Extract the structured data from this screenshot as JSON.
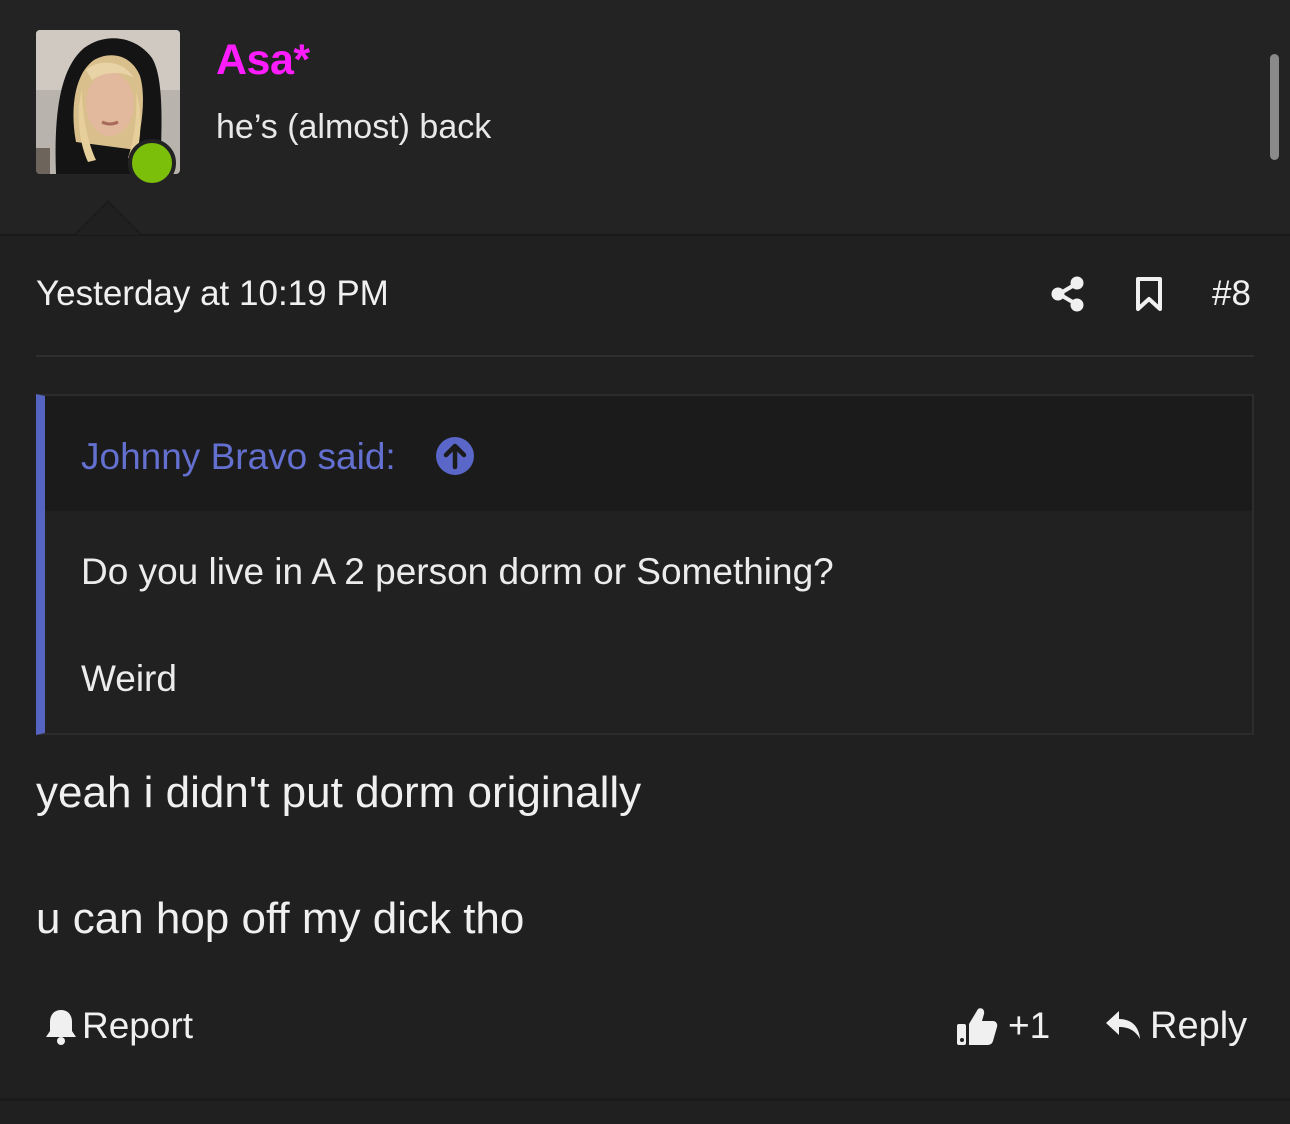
{
  "colors": {
    "background": "#202020",
    "username": "#ff1dff",
    "quote_accent": "#5563c1",
    "online": "#7bbf0b"
  },
  "user": {
    "name": "Asa*",
    "title": "he’s (almost) back",
    "avatar_icon": "profile-photo",
    "online_icon": "online-status-dot"
  },
  "post": {
    "timestamp": "Yesterday at 10:19 PM",
    "number": "#8",
    "share_icon": "share-icon",
    "bookmark_icon": "bookmark-icon",
    "quote": {
      "author": "Johnny Bravo said:",
      "jump_icon": "arrow-up-circle-icon",
      "lines": [
        "Do you live in A 2 person dorm or Something?",
        "Weird"
      ]
    },
    "body": [
      "yeah i didn't put dorm originally",
      "u can hop off my dick tho"
    ]
  },
  "actions": {
    "report_label": "Report",
    "like_label": "+1",
    "reply_label": "Reply"
  }
}
